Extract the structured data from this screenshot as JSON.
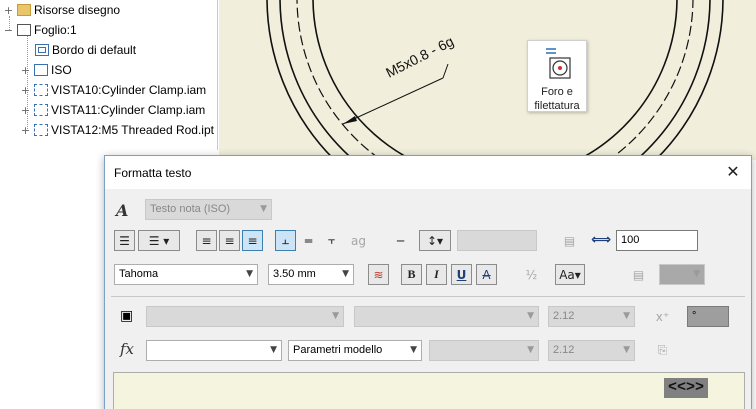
{
  "browser": {
    "items": [
      {
        "label": "Risorse disegno",
        "expander": "+",
        "icon": "folder-icon"
      },
      {
        "label": "Foglio:1",
        "expander": "−",
        "icon": "sheet-icon"
      },
      {
        "label": "Bordo di default",
        "expander": "",
        "icon": "border-icon"
      },
      {
        "label": "ISO",
        "expander": "+",
        "icon": "title-block-icon"
      },
      {
        "label": "VISTA10:Cylinder Clamp.iam",
        "expander": "+",
        "icon": "drawing-view-icon"
      },
      {
        "label": "VISTA11:Cylinder Clamp.iam",
        "expander": "+",
        "icon": "drawing-view-icon"
      },
      {
        "label": "VISTA12:M5 Threaded Rod.ipt",
        "expander": "+",
        "icon": "drawing-view-icon"
      }
    ]
  },
  "canvas": {
    "background": "#f1efdb",
    "dimension_text": "M5x0.8 - 6g",
    "hover_button_label_1": "Foro e",
    "hover_button_label_2": "filettatura"
  },
  "dialog": {
    "title": "Formatta testo",
    "close_glyph": "✕",
    "style_combo": "Testo nota (ISO)",
    "width_scale": "100",
    "font_combo": "Tahoma",
    "size_combo": "3.50 mm",
    "bold_label": "B",
    "italic_label": "I",
    "underline_label": "U",
    "strike_label": "A",
    "param_precision_1": "2.12",
    "model_params_combo": "Parametri modello",
    "param_precision_2": "2.12",
    "symbol_combo": "°",
    "fx_label": "fx",
    "editor_token": "<<>>"
  }
}
